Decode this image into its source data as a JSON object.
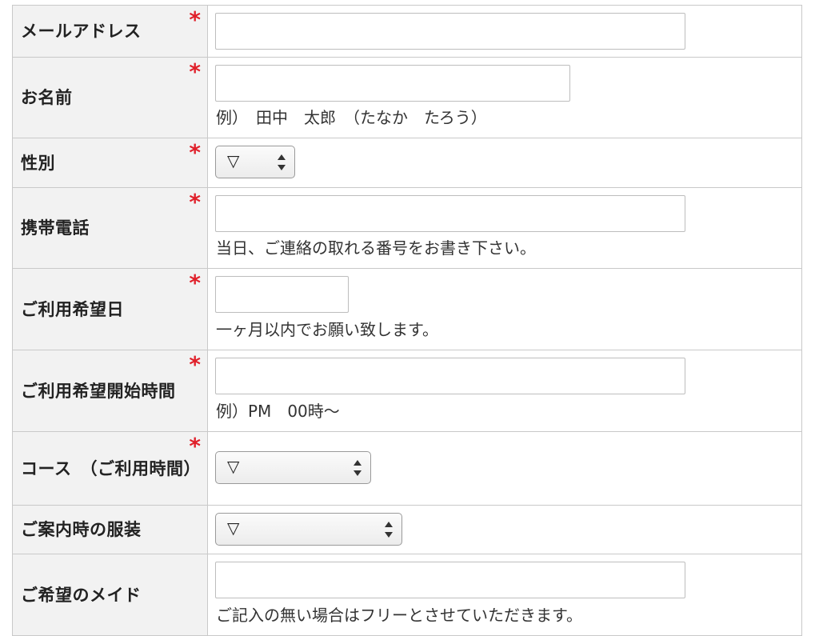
{
  "required_mark": "*",
  "rows": [
    {
      "label": "メールアドレス",
      "required": true,
      "hint": ""
    },
    {
      "label": "お名前",
      "required": true,
      "hint": "例）　田中　太郎　（たなか　たろう）"
    },
    {
      "label": "性別",
      "required": true,
      "select_value": "▽"
    },
    {
      "label": "携帯電話",
      "required": true,
      "hint": "当日、ご連絡の取れる番号をお書き下さい。"
    },
    {
      "label": "ご利用希望日",
      "required": true,
      "hint": "一ヶ月以内でお願い致します。"
    },
    {
      "label": "ご利用希望開始時間",
      "required": true,
      "hint": "例）PM　00時〜"
    },
    {
      "label": "コース　（ご利用時間）",
      "required": true,
      "select_value": "▽"
    },
    {
      "label": "ご案内時の服装",
      "required": false,
      "select_value": "▽"
    },
    {
      "label": "ご希望のメイド",
      "required": false,
      "hint": "ご記入の無い場合はフリーとさせていただきます。"
    }
  ],
  "colors": {
    "required": "#e0202a",
    "label_bg": "#f2f2f2",
    "border": "#c9c9c9"
  }
}
